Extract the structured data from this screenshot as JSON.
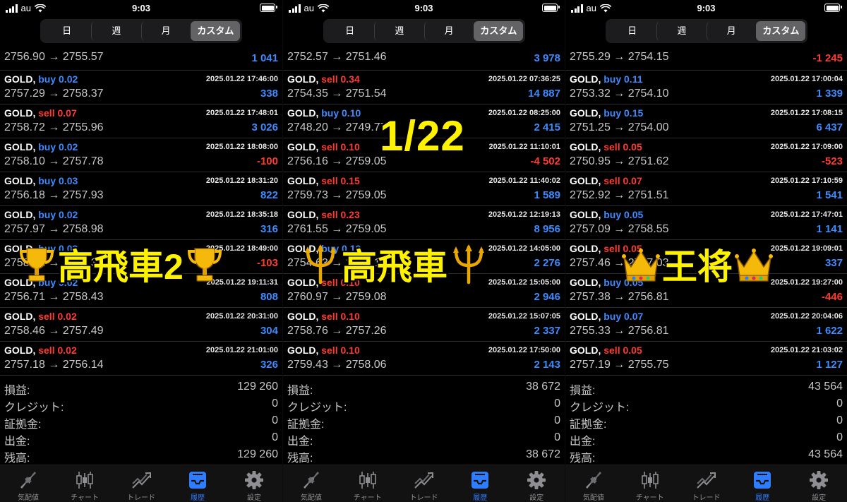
{
  "status": {
    "carrier": "au",
    "time": "9:03"
  },
  "segments": [
    "日",
    "週",
    "月",
    "カスタム"
  ],
  "active_segment": 3,
  "symbol": "GOLD,",
  "summary_labels": [
    "損益:",
    "クレジット:",
    "証拠金:",
    "出金:",
    "残高:"
  ],
  "tabs": [
    "気配値",
    "チャート",
    "トレード",
    "履歴",
    "設定"
  ],
  "active_tab": 3,
  "colors": {
    "buy": "#3d8bff",
    "sell": "#ff3b30",
    "profit_pos": "#3d8bff",
    "profit_neg": "#ff3b30",
    "overlay": "#fff200"
  },
  "overlays": {
    "date": "1/22",
    "left": {
      "text": "高飛車2",
      "icon": "trophy-icon"
    },
    "middle": {
      "text": "高飛車",
      "icon": "trident-icon"
    },
    "right": {
      "text": "王将",
      "icon": "crown-icon"
    }
  },
  "panels": [
    {
      "first_row": {
        "prices": "2756.90 → 2755.57",
        "profit": "1 041"
      },
      "trades": [
        {
          "side": "buy",
          "vol": "0.02",
          "time": "2025.01.22 17:46:00",
          "prices": "2757.29 → 2758.37",
          "profit": "338"
        },
        {
          "side": "sell",
          "vol": "0.07",
          "time": "2025.01.22 17:48:01",
          "prices": "2758.72 → 2755.96",
          "profit": "3 026"
        },
        {
          "side": "buy",
          "vol": "0.02",
          "time": "2025.01.22 18:08:00",
          "prices": "2758.10 → 2757.78",
          "profit": "-100"
        },
        {
          "side": "buy",
          "vol": "0.03",
          "time": "2025.01.22 18:31:20",
          "prices": "2756.18 → 2757.93",
          "profit": "822"
        },
        {
          "side": "buy",
          "vol": "0.02",
          "time": "2025.01.22 18:35:18",
          "prices": "2757.97 → 2758.98",
          "profit": "316"
        },
        {
          "side": "buy",
          "vol": "0.02",
          "time": "2025.01.22 18:49:00",
          "prices": "2758.51 → 2757.37",
          "profit": "-103"
        },
        {
          "side": "buy",
          "vol": "0.02",
          "time": "2025.01.22 19:11:31",
          "prices": "2756.71 → 2758.43",
          "profit": "808"
        },
        {
          "side": "sell",
          "vol": "0.02",
          "time": "2025.01.22 20:31:00",
          "prices": "2758.46 → 2757.49",
          "profit": "304"
        },
        {
          "side": "sell",
          "vol": "0.02",
          "time": "2025.01.22 21:01:00",
          "prices": "2757.18 → 2756.14",
          "profit": "326"
        }
      ],
      "summary": [
        "129 260",
        "0",
        "0",
        "0",
        "129 260"
      ]
    },
    {
      "first_row": {
        "prices": "2752.57 → 2751.46",
        "profit": "3 978"
      },
      "trades": [
        {
          "side": "sell",
          "vol": "0.34",
          "time": "2025.01.22 07:36:25",
          "prices": "2754.35 → 2751.54",
          "profit": "14 887"
        },
        {
          "side": "buy",
          "vol": "0.10",
          "time": "2025.01.22 08:25:00",
          "prices": "2748.20 → 2749.77",
          "profit": "2 415"
        },
        {
          "side": "sell",
          "vol": "0.10",
          "time": "2025.01.22 11:10:01",
          "prices": "2756.16 → 2759.05",
          "profit": "-4 502"
        },
        {
          "side": "sell",
          "vol": "0.15",
          "time": "2025.01.22 11:40:02",
          "prices": "2759.73 → 2759.05",
          "profit": "1 589"
        },
        {
          "side": "sell",
          "vol": "0.23",
          "time": "2025.01.22 12:19:13",
          "prices": "2761.55 → 2759.05",
          "profit": "8 956"
        },
        {
          "side": "buy",
          "vol": "0.10",
          "time": "2025.01.22 14:05:00",
          "prices": "2754.63 → 2756.10",
          "profit": "2 276"
        },
        {
          "side": "sell",
          "vol": "0.10",
          "time": "2025.01.22 15:05:00",
          "prices": "2760.97 → 2759.08",
          "profit": "2 946"
        },
        {
          "side": "sell",
          "vol": "0.10",
          "time": "2025.01.22 15:07:05",
          "prices": "2758.76 → 2757.26",
          "profit": "2 337"
        },
        {
          "side": "sell",
          "vol": "0.10",
          "time": "2025.01.22 17:50:00",
          "prices": "2759.43 → 2758.06",
          "profit": "2 143"
        }
      ],
      "summary": [
        "38 672",
        "0",
        "0",
        "0",
        "38 672"
      ]
    },
    {
      "first_row": {
        "prices": "2755.29 → 2754.15",
        "profit": "-1 245"
      },
      "trades": [
        {
          "side": "buy",
          "vol": "0.11",
          "time": "2025.01.22 17:00:04",
          "prices": "2753.32 → 2754.10",
          "profit": "1 339"
        },
        {
          "side": "buy",
          "vol": "0.15",
          "time": "2025.01.22 17:08:15",
          "prices": "2751.25 → 2754.00",
          "profit": "6 437"
        },
        {
          "side": "sell",
          "vol": "0.05",
          "time": "2025.01.22 17:09:00",
          "prices": "2750.95 → 2751.62",
          "profit": "-523"
        },
        {
          "side": "sell",
          "vol": "0.07",
          "time": "2025.01.22 17:10:59",
          "prices": "2752.92 → 2751.51",
          "profit": "1 541"
        },
        {
          "side": "buy",
          "vol": "0.05",
          "time": "2025.01.22 17:47:01",
          "prices": "2757.09 → 2758.55",
          "profit": "1 141"
        },
        {
          "side": "sell",
          "vol": "0.05",
          "time": "2025.01.22 19:09:01",
          "prices": "2757.46 → 2757.03",
          "profit": "337"
        },
        {
          "side": "buy",
          "vol": "0.05",
          "time": "2025.01.22 19:27:00",
          "prices": "2757.38 → 2756.81",
          "profit": "-446"
        },
        {
          "side": "buy",
          "vol": "0.07",
          "time": "2025.01.22 20:04:06",
          "prices": "2755.33 → 2756.81",
          "profit": "1 622"
        },
        {
          "side": "sell",
          "vol": "0.05",
          "time": "2025.01.22 21:03:02",
          "prices": "2757.19 → 2755.75",
          "profit": "1 127"
        }
      ],
      "summary": [
        "43 564",
        "0",
        "0",
        "0",
        "43 564"
      ]
    }
  ]
}
